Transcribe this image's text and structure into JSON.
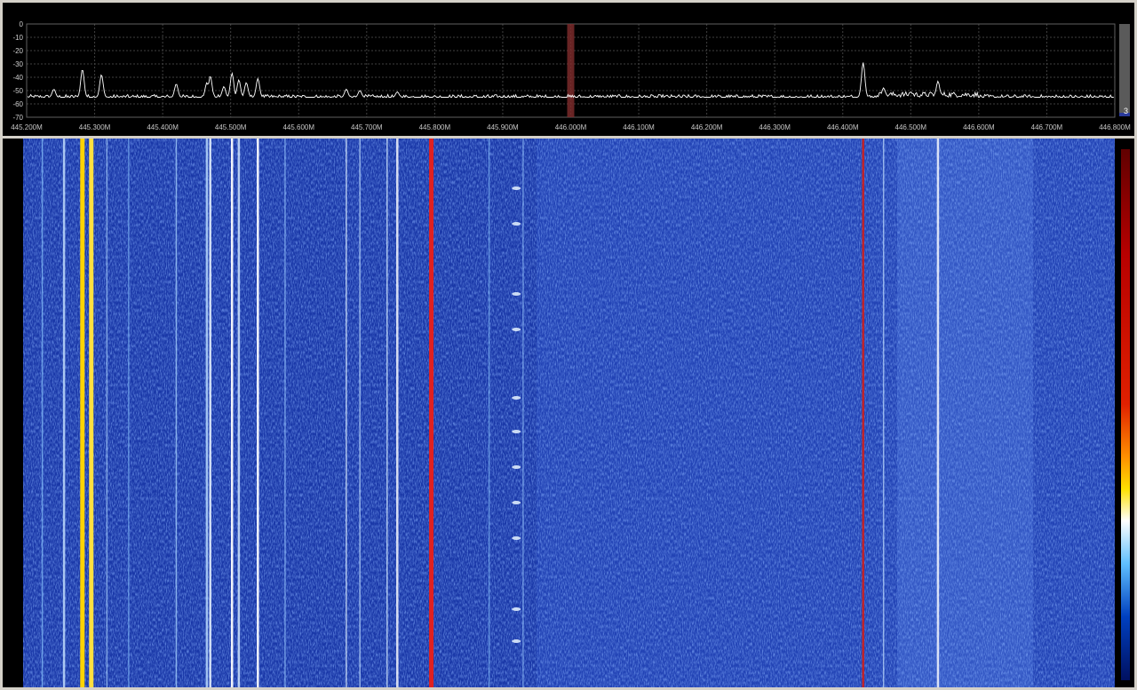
{
  "spectrum": {
    "y_ticks": [
      "0",
      "-10",
      "-20",
      "-30",
      "-40",
      "-50",
      "-60",
      "-70"
    ],
    "y_range": [
      -70,
      0
    ],
    "freq_ticks": [
      "445.200M",
      "445.300M",
      "445.400M",
      "445.500M",
      "445.600M",
      "445.700M",
      "445.800M",
      "445.900M",
      "446.000M",
      "446.100M",
      "446.200M",
      "446.300M",
      "446.400M",
      "446.500M",
      "446.600M",
      "446.700M",
      "446.800M"
    ],
    "freq_range_mhz": [
      445.2,
      446.8
    ],
    "center_marker_mhz": 446.0,
    "trace_color": "#ffffff",
    "grid_color": "#404040",
    "marker_color": "#7a2a2a",
    "noise_floor_db": -55,
    "peaks": [
      {
        "f": 445.24,
        "db": -49
      },
      {
        "f": 445.282,
        "db": -34
      },
      {
        "f": 445.31,
        "db": -38
      },
      {
        "f": 445.42,
        "db": -45
      },
      {
        "f": 445.465,
        "db": -44
      },
      {
        "f": 445.47,
        "db": -39
      },
      {
        "f": 445.49,
        "db": -47
      },
      {
        "f": 445.502,
        "db": -37
      },
      {
        "f": 445.512,
        "db": -42
      },
      {
        "f": 445.523,
        "db": -44
      },
      {
        "f": 445.54,
        "db": -41
      },
      {
        "f": 445.67,
        "db": -49
      },
      {
        "f": 445.69,
        "db": -50
      },
      {
        "f": 445.745,
        "db": -51
      },
      {
        "f": 446.43,
        "db": -29
      },
      {
        "f": 446.46,
        "db": -48
      },
      {
        "f": 446.5,
        "db": -51
      },
      {
        "f": 446.54,
        "db": -43
      }
    ]
  },
  "scrollbar": {
    "value": "3"
  },
  "waterfall": {
    "background_color": "#1a38a8",
    "colorbar_stops": [
      "#600000",
      "#b80000",
      "#ffe000",
      "#ffffff",
      "#60c0ff",
      "#001060"
    ],
    "signals": [
      {
        "f": 445.223,
        "color": "#8cc8ff",
        "intensity": 0.5
      },
      {
        "f": 445.255,
        "color": "#c8e4ff",
        "intensity": 0.7
      },
      {
        "f": 445.282,
        "color": "#ffd400",
        "intensity": 1.0
      },
      {
        "f": 445.295,
        "color": "#ffe040",
        "intensity": 1.0
      },
      {
        "f": 445.318,
        "color": "#b0d8ff",
        "intensity": 0.4
      },
      {
        "f": 445.35,
        "color": "#8cc8ff",
        "intensity": 0.3
      },
      {
        "f": 445.42,
        "color": "#a8d4ff",
        "intensity": 0.6
      },
      {
        "f": 445.465,
        "color": "#c0e0ff",
        "intensity": 0.7
      },
      {
        "f": 445.47,
        "color": "#e8f4ff",
        "intensity": 0.8
      },
      {
        "f": 445.502,
        "color": "#ffffff",
        "intensity": 0.9
      },
      {
        "f": 445.512,
        "color": "#d8ecff",
        "intensity": 0.7
      },
      {
        "f": 445.54,
        "color": "#ffffff",
        "intensity": 0.9
      },
      {
        "f": 445.58,
        "color": "#9ccaff",
        "intensity": 0.4
      },
      {
        "f": 445.67,
        "color": "#e0f0ff",
        "intensity": 0.6
      },
      {
        "f": 445.69,
        "color": "#c4e2ff",
        "intensity": 0.5
      },
      {
        "f": 445.73,
        "color": "#d6ecff",
        "intensity": 0.6
      },
      {
        "f": 445.745,
        "color": "#ffffff",
        "intensity": 0.7
      },
      {
        "f": 445.795,
        "color": "#e02020",
        "intensity": 1.0
      },
      {
        "f": 445.88,
        "color": "#8cc8ff",
        "intensity": 0.3
      },
      {
        "f": 445.93,
        "color": "#9ccaff",
        "intensity": 0.3
      },
      {
        "f": 446.43,
        "color": "#c82020",
        "intensity": 0.9
      },
      {
        "f": 446.46,
        "color": "#c8e4ff",
        "intensity": 0.5
      },
      {
        "f": 446.54,
        "color": "#ffffff",
        "intensity": 0.7
      }
    ]
  }
}
